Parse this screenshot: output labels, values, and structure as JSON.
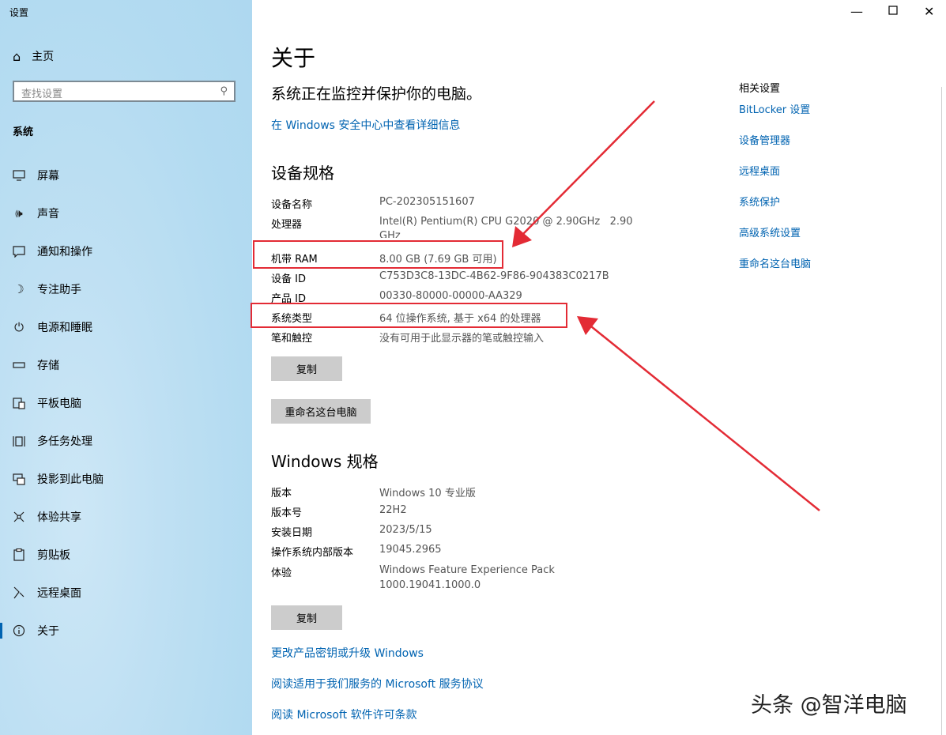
{
  "window": {
    "title": "设置"
  },
  "sidebar": {
    "home_label": "主页",
    "search_placeholder": "查找设置",
    "section_label": "系统",
    "items": [
      {
        "label": "屏幕",
        "icon": "monitor-icon"
      },
      {
        "label": "声音",
        "icon": "speaker-icon"
      },
      {
        "label": "通知和操作",
        "icon": "notification-icon"
      },
      {
        "label": "专注助手",
        "icon": "moon-icon"
      },
      {
        "label": "电源和睡眠",
        "icon": "power-icon"
      },
      {
        "label": "存储",
        "icon": "storage-icon"
      },
      {
        "label": "平板电脑",
        "icon": "tablet-icon"
      },
      {
        "label": "多任务处理",
        "icon": "multitask-icon"
      },
      {
        "label": "投影到此电脑",
        "icon": "project-icon"
      },
      {
        "label": "体验共享",
        "icon": "share-icon"
      },
      {
        "label": "剪贴板",
        "icon": "clipboard-icon"
      },
      {
        "label": "远程桌面",
        "icon": "remote-icon"
      },
      {
        "label": "关于",
        "icon": "info-icon"
      }
    ]
  },
  "main": {
    "title": "关于",
    "subtitle": "系统正在监控并保护你的电脑。",
    "security_link": "在 Windows 安全中心中查看详细信息",
    "device_specs": {
      "heading": "设备规格",
      "rows": [
        {
          "k": "设备名称",
          "v": "PC-202305151607"
        },
        {
          "k": "处理器",
          "v": "Intel(R) Pentium(R) CPU G2020 @ 2.90GHz   2.90",
          "v2": "GHz"
        },
        {
          "k": "机带 RAM",
          "v": "8.00 GB (7.69 GB 可用)"
        },
        {
          "k": "设备 ID",
          "v": "C753D3C8-13DC-4B62-9F86-904383C0217B"
        },
        {
          "k": "产品 ID",
          "v": "00330-80000-00000-AA329"
        },
        {
          "k": "系统类型",
          "v": "64 位操作系统, 基于 x64 的处理器"
        },
        {
          "k": "笔和触控",
          "v": "没有可用于此显示器的笔或触控输入"
        }
      ],
      "copy_label": "复制",
      "rename_label": "重命名这台电脑"
    },
    "windows_specs": {
      "heading": "Windows 规格",
      "rows": [
        {
          "k": "版本",
          "v": "Windows 10 专业版"
        },
        {
          "k": "版本号",
          "v": "22H2"
        },
        {
          "k": "安装日期",
          "v": "2023/5/15"
        },
        {
          "k": "操作系统内部版本",
          "v": "19045.2965"
        },
        {
          "k": "体验",
          "v": "Windows Feature Experience Pack",
          "v2": "1000.19041.1000.0"
        }
      ],
      "copy_label": "复制"
    },
    "links": [
      "更改产品密钥或升级 Windows",
      "阅读适用于我们服务的 Microsoft 服务协议",
      "阅读 Microsoft 软件许可条款"
    ]
  },
  "related": {
    "title": "相关设置",
    "links": [
      "BitLocker 设置",
      "设备管理器",
      "远程桌面",
      "系统保护",
      "高级系统设置",
      "重命名这台电脑"
    ]
  },
  "watermark": "头条 @智洋电脑",
  "colors": {
    "accent": "#0063b1",
    "annotation": "#e32b35"
  }
}
